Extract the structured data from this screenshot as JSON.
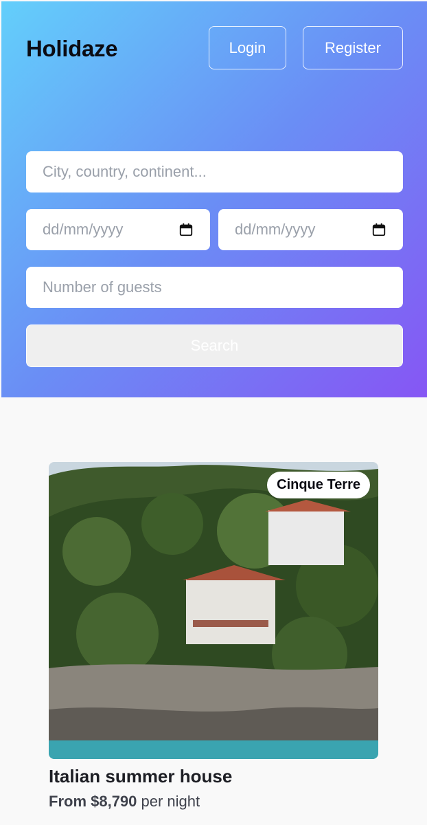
{
  "header": {
    "brand": "Holidaze",
    "login_label": "Login",
    "register_label": "Register"
  },
  "search": {
    "location_placeholder": "City, country, continent...",
    "checkin_placeholder": "dd/mm/yyyy",
    "checkout_placeholder": "dd/mm/yyyy",
    "guests_placeholder": "Number of guests",
    "button_label": "Search",
    "calendar_icon": "calendar-icon"
  },
  "listing": {
    "badge": "Cinque Terre",
    "title": "Italian summer house",
    "price_prefix": "From $8,790",
    "price_suffix": " per night",
    "image_description": "hillside villas by the sea"
  },
  "colors": {
    "gradient_start": "#63cffb",
    "gradient_end": "#8656f4",
    "page_bg": "#f9f9f9"
  }
}
